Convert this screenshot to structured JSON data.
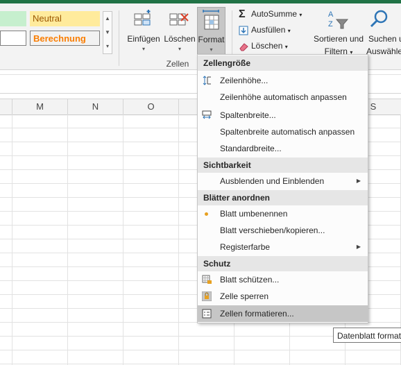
{
  "styles": {
    "neutral": "Neutral",
    "berechnung": "Berechnung"
  },
  "cells_group": {
    "einfuegen": "Einfügen",
    "loeschen": "Löschen",
    "format": "Format",
    "label": "Zellen"
  },
  "editing": {
    "autosumme": "AutoSumme",
    "ausfuellen": "Ausfüllen",
    "loeschen": "Löschen",
    "sortieren_line1": "Sortieren und",
    "sortieren_line2": "Filtern",
    "suchen_line1": "Suchen u",
    "suchen_line2": "Auswähle"
  },
  "columns": [
    "M",
    "N",
    "O",
    "S"
  ],
  "format_menu": {
    "sections": [
      {
        "header": "Zellengröße",
        "items": [
          {
            "label": "Zeilenhöhe...",
            "icon": "row-height-icon"
          },
          {
            "label": "Zeilenhöhe automatisch anpassen"
          },
          {
            "label": "Spaltenbreite...",
            "icon": "column-width-icon"
          },
          {
            "label": "Spaltenbreite automatisch anpassen"
          },
          {
            "label": "Standardbreite..."
          }
        ]
      },
      {
        "header": "Sichtbarkeit",
        "items": [
          {
            "label": "Ausblenden und Einblenden",
            "submenu": true
          }
        ]
      },
      {
        "header": "Blätter anordnen",
        "items": [
          {
            "label": "Blatt umbenennen",
            "bullet": true
          },
          {
            "label": "Blatt verschieben/kopieren..."
          },
          {
            "label": "Registerfarbe",
            "submenu": true
          }
        ]
      },
      {
        "header": "Schutz",
        "items": [
          {
            "label": "Blatt schützen...",
            "icon": "protect-sheet-icon"
          },
          {
            "label": "Zelle sperren",
            "icon": "lock-cell-icon"
          },
          {
            "label": "Zellen formatieren...",
            "icon": "format-cells-icon",
            "selected": true
          }
        ]
      }
    ]
  },
  "tooltip": "Datenblatt format",
  "colors": {
    "accent_green": "#217346",
    "selected_item": "#c6c6c6",
    "bullet": "#e7a020"
  }
}
